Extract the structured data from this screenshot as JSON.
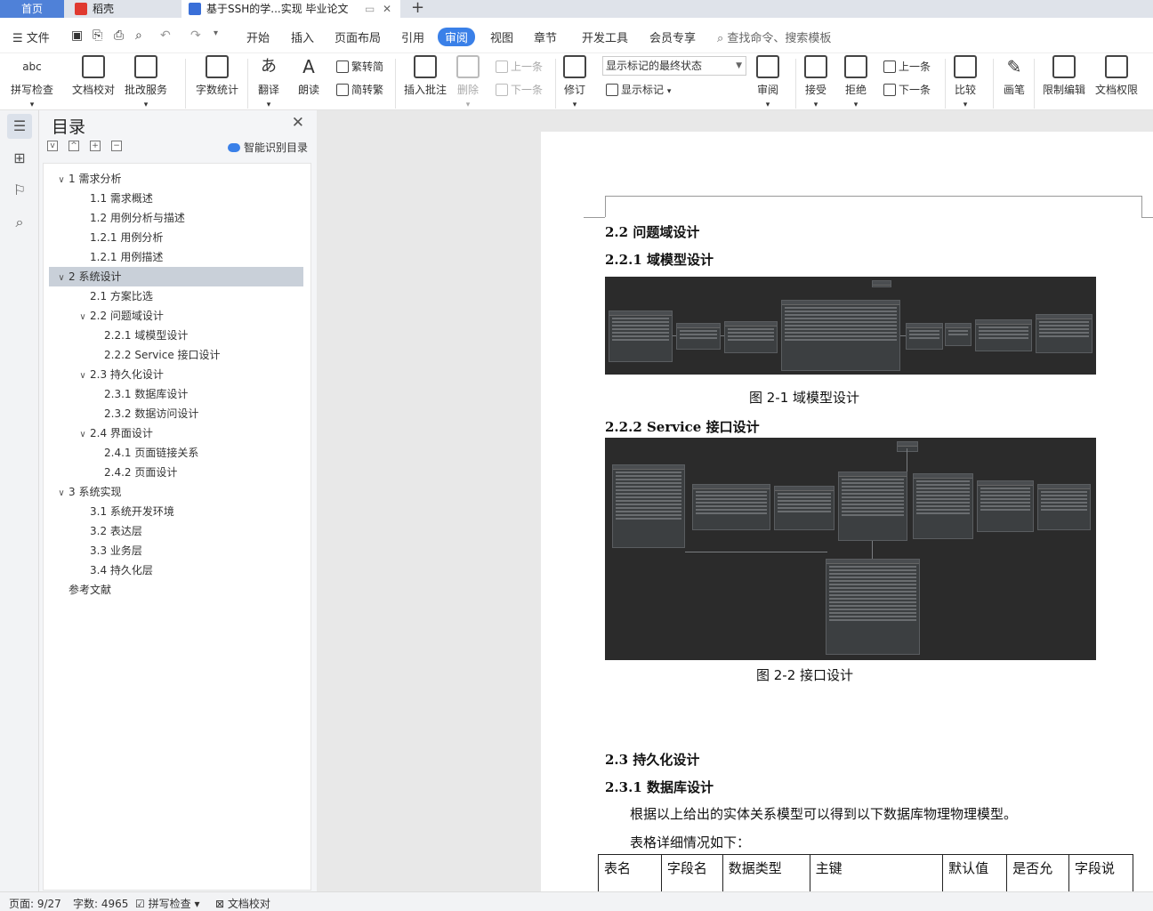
{
  "tabs": {
    "home": "首页",
    "docer": "稻壳",
    "doc": "基于SSH的学...实现 毕业论文",
    "new_tab": "+"
  },
  "menu": {
    "file": "文件",
    "items": [
      "开始",
      "插入",
      "页面布局",
      "引用",
      "审阅",
      "视图",
      "章节",
      "开发工具",
      "会员专享"
    ],
    "active": "审阅",
    "search_placeholder": "查找命令、搜索模板"
  },
  "ribbon": {
    "spell_check": "拼写检查",
    "doc_proofread": "文档校对",
    "revision_service": "批改服务",
    "word_count": "字数统计",
    "translate": "翻译",
    "read_aloud": "朗读",
    "trad_to_simp": "繁转简",
    "simp_to_trad": "简转繁",
    "insert_comment": "插入批注",
    "delete": "删除",
    "prev_comment": "上一条",
    "next_comment": "下一条",
    "track_changes": "修订",
    "markup_select": "显示标记的最终状态",
    "show_markup": "显示标记",
    "review": "审阅",
    "accept": "接受",
    "reject": "拒绝",
    "prev_change": "上一条",
    "next_change": "下一条",
    "compare": "比较",
    "pen": "画笔",
    "restrict_edit": "限制编辑",
    "doc_permission": "文档权限"
  },
  "toc": {
    "title": "目录",
    "smart_toc": "智能识别目录",
    "items": [
      {
        "label": "1  需求分析",
        "level": 1,
        "expandable": true
      },
      {
        "label": "1.1 需求概述",
        "level": 2,
        "expandable": false
      },
      {
        "label": "1.2  用例分析与描述",
        "level": 2,
        "expandable": false
      },
      {
        "label": "1.2.1  用例分析",
        "level": 2,
        "expandable": false
      },
      {
        "label": "1.2.1  用例描述",
        "level": 2,
        "expandable": false
      },
      {
        "label": "2  系统设计",
        "level": 1,
        "expandable": true,
        "selected": true
      },
      {
        "label": "2.1  方案比选",
        "level": 2,
        "expandable": false
      },
      {
        "label": "2.2  问题域设计",
        "level": 2,
        "expandable": true
      },
      {
        "label": "2.2.1  域模型设计",
        "level": 3,
        "expandable": false
      },
      {
        "label": "2.2.2    Service 接口设计",
        "level": 3,
        "expandable": false
      },
      {
        "label": "2.3  持久化设计",
        "level": 2,
        "expandable": true
      },
      {
        "label": "2.3.1  数据库设计",
        "level": 3,
        "expandable": false
      },
      {
        "label": "2.3.2  数据访问设计",
        "level": 3,
        "expandable": false
      },
      {
        "label": "2.4  界面设计",
        "level": 2,
        "expandable": true
      },
      {
        "label": "2.4.1  页面链接关系",
        "level": 3,
        "expandable": false
      },
      {
        "label": "2.4.2  页面设计",
        "level": 3,
        "expandable": false
      },
      {
        "label": "3  系统实现",
        "level": 1,
        "expandable": true
      },
      {
        "label": "3.1  系统开发环境",
        "level": 2,
        "expandable": false
      },
      {
        "label": "3.2  表达层",
        "level": 2,
        "expandable": false
      },
      {
        "label": "3.3  业务层",
        "level": 2,
        "expandable": false
      },
      {
        "label": "3.4  持久化层",
        "level": 2,
        "expandable": false
      },
      {
        "label": "参考文献",
        "level": 0,
        "expandable": false
      }
    ]
  },
  "document": {
    "h_2_2": "2.2  问题域设计",
    "h_2_2_1": "2.2.1  域模型设计",
    "fig1_caption": "图  2-1  域模型设计",
    "h_2_2_2": "2.2.2    Service 接口设计",
    "fig2_caption": "图  2-2  接口设计",
    "h_2_3": "2.3  持久化设计",
    "h_2_3_1": "2.3.1  数据库设计",
    "para1": "根据以上给出的实体关系模型可以得到以下数据库物理物理模型。",
    "para2": "表格详细情况如下：",
    "table_headers": [
      "表名",
      "字段名",
      "数据类型",
      "主键",
      "默认值",
      "是否允",
      "字段说"
    ]
  },
  "status": {
    "page": "页面: 9/27",
    "words": "字数: 4965",
    "spell": "拼写检查",
    "proof": "文档校对"
  }
}
